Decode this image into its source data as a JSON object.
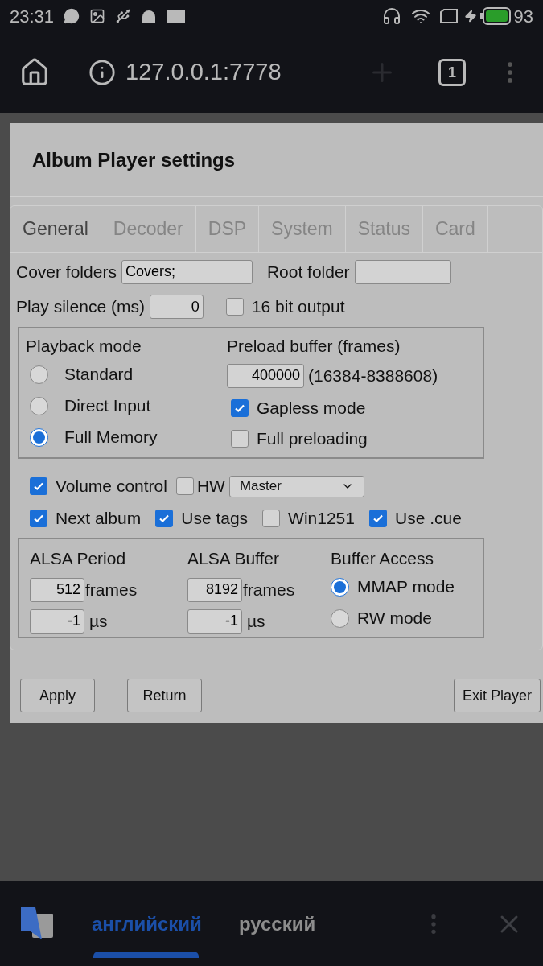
{
  "status_bar": {
    "time": "23:31",
    "battery": "93"
  },
  "browser": {
    "url": "127.0.0.1:7778",
    "tab_count": "1"
  },
  "dialog": {
    "title": "Album Player settings",
    "tabs": [
      {
        "label": "General",
        "selected": true
      },
      {
        "label": "Decoder",
        "selected": false
      },
      {
        "label": "DSP",
        "selected": false
      },
      {
        "label": "System",
        "selected": false
      },
      {
        "label": "Status",
        "selected": false
      },
      {
        "label": "Card",
        "selected": false
      }
    ],
    "cover_folders": {
      "label": "Cover folders",
      "value": "Covers;"
    },
    "root_folder": {
      "label": "Root folder"
    },
    "play_silence": {
      "label": "Play silence (ms)",
      "value": "0"
    },
    "bit16_output": {
      "label": "16 bit output",
      "checked": false
    },
    "playback_mode": {
      "label": "Playback mode",
      "options": [
        {
          "label": "Standard",
          "selected": false
        },
        {
          "label": "Direct Input",
          "selected": false
        },
        {
          "label": "Full Memory",
          "selected": true
        }
      ]
    },
    "preload_buffer": {
      "label": "Preload buffer (frames)",
      "value": "400000",
      "range": "(16384-8388608)"
    },
    "gapless_mode": {
      "label": "Gapless mode",
      "checked": true
    },
    "full_preloading": {
      "label": "Full preloading",
      "checked": false
    },
    "volume_control": {
      "label": "Volume control",
      "checked": true
    },
    "hw": {
      "label": "HW",
      "checked": false
    },
    "mixer": {
      "value": "Master"
    },
    "options": [
      {
        "label": "Next album",
        "checked": true
      },
      {
        "label": "Use tags",
        "checked": true
      },
      {
        "label": "Win1251",
        "checked": false
      },
      {
        "label": "Use .cue",
        "checked": true
      }
    ],
    "alsa_period": {
      "label": "ALSA Period",
      "frames": "512",
      "frames_unit": "frames",
      "us": "-1",
      "us_unit": "µs"
    },
    "alsa_buffer": {
      "label": "ALSA Buffer",
      "frames": "8192",
      "frames_unit": "frames",
      "us": "-1",
      "us_unit": "µs"
    },
    "buffer_access": {
      "label": "Buffer Access",
      "options": [
        {
          "label": "MMAP mode",
          "selected": true
        },
        {
          "label": "RW mode",
          "selected": false
        }
      ]
    },
    "buttons": [
      "Apply",
      "Return",
      "Exit Player"
    ]
  },
  "translate_bar": {
    "languages": [
      {
        "label": "английский",
        "selected": true
      },
      {
        "label": "русский",
        "selected": false
      }
    ]
  }
}
